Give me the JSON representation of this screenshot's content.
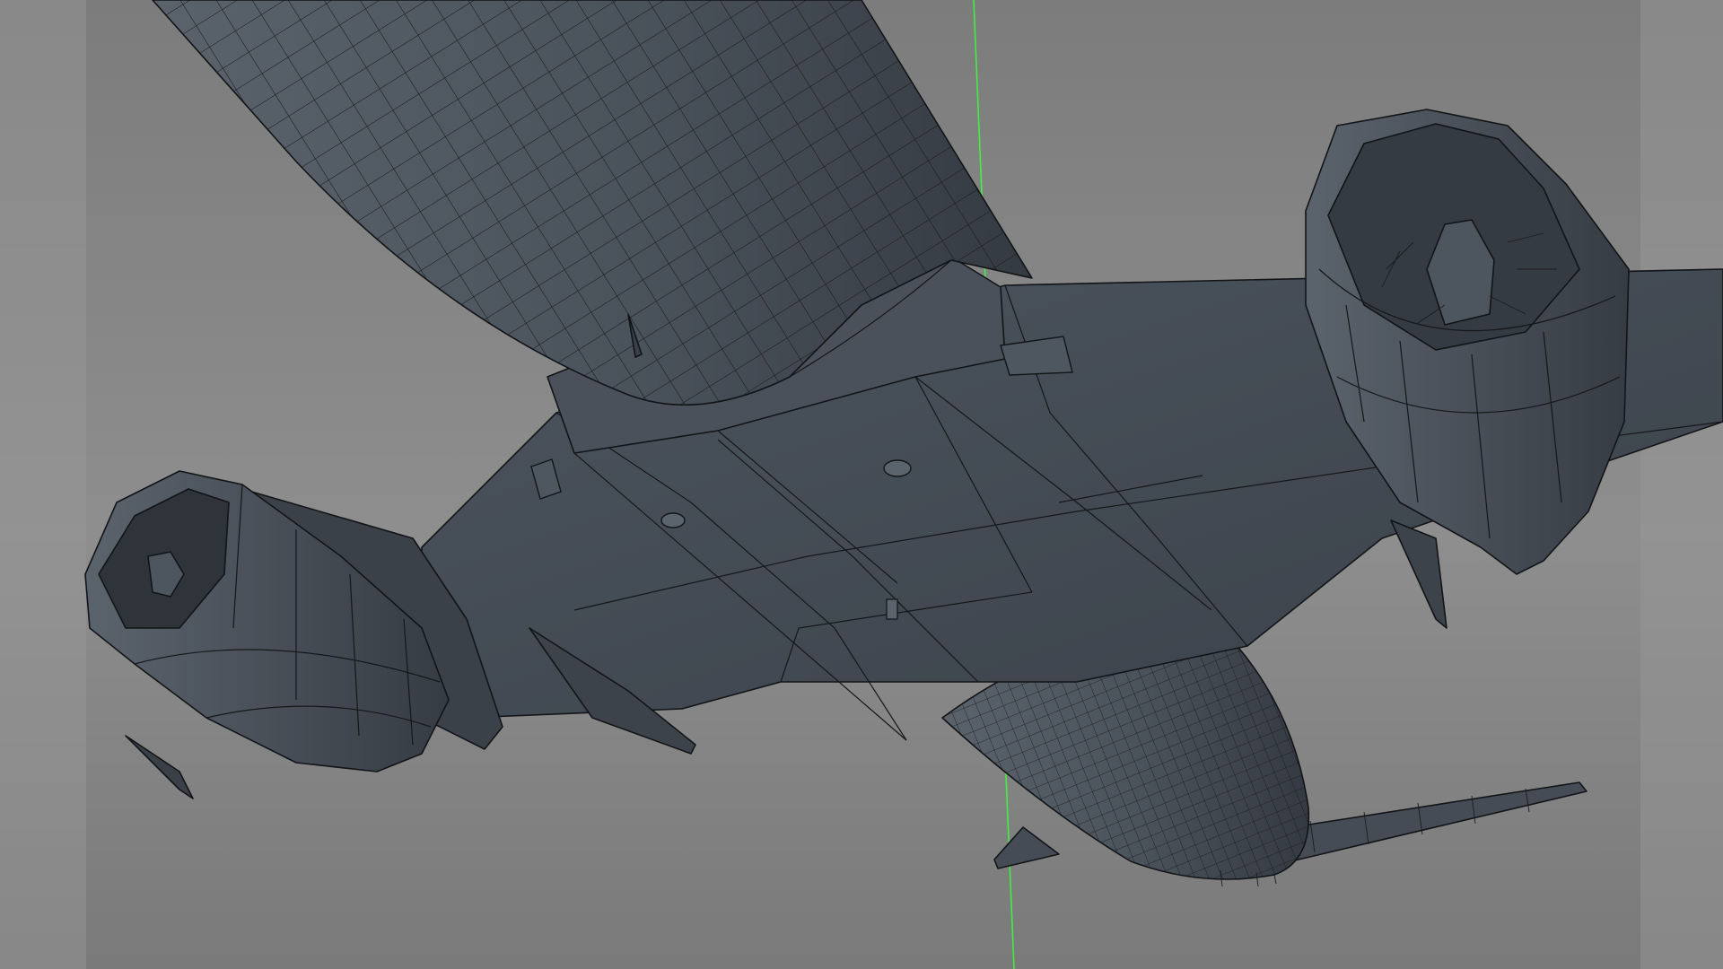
{
  "viewport": {
    "label": "3D viewport",
    "background_color": "#8b8b8b",
    "mesh_color": "#3f464f",
    "wire_color": "#121417",
    "axis_color": "#3cff3c"
  },
  "scene": {
    "object": "aircraft-wireframe-model",
    "view": "underside-perspective"
  }
}
